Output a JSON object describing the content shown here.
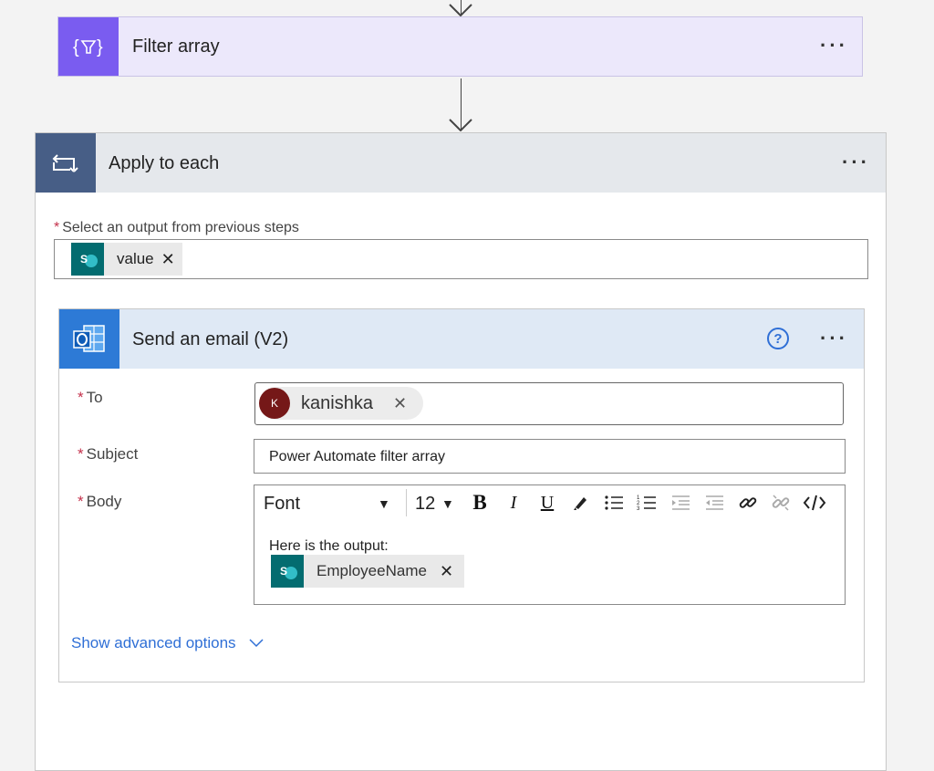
{
  "filter_card": {
    "title": "Filter array",
    "more": "···"
  },
  "apply_card": {
    "title": "Apply to each",
    "more": "···",
    "select_label": "Select an output from previous steps",
    "token_label": "value",
    "remove_glyph": "✕"
  },
  "email_card": {
    "title": "Send an email (V2)",
    "more": "···",
    "help": "?",
    "to_label": "To",
    "subject_label": "Subject",
    "body_label": "Body",
    "to_recipient": "kanishka",
    "to_avatar_initial": "K",
    "subject_value": "Power Automate filter array",
    "toolbar": {
      "font": "Font",
      "size": "12"
    },
    "body_text": "Here is the output:",
    "body_token": "EmployeeName",
    "advanced": "Show advanced options"
  },
  "required_mark": "*",
  "sharepoint_letter": "S"
}
